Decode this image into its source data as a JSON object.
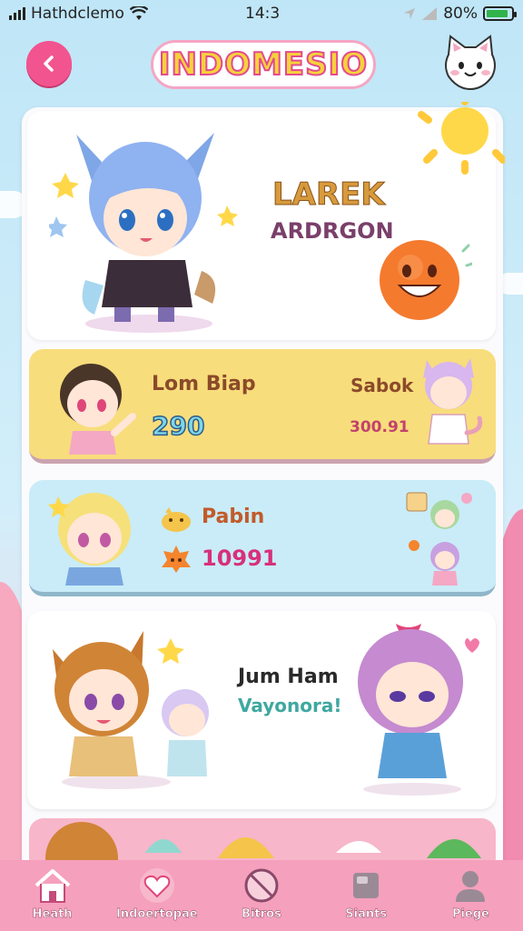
{
  "status_bar": {
    "carrier": "Hathdclemo",
    "time": "14:3",
    "battery": "80%"
  },
  "header": {
    "title": "INDOMESIO",
    "back_icon": "chevron-left-icon",
    "profile_icon": "cat-face-icon"
  },
  "hero_card": {
    "name": "LAREK",
    "subtitle": "ARDRGON"
  },
  "card_yellow": {
    "title": "Lom Biap",
    "score": "290",
    "right_title": "Sabok",
    "right_value": "300.91"
  },
  "card_blue": {
    "title": "Pabin",
    "value": "10991"
  },
  "card_white": {
    "title": "Jum Ham",
    "subtitle": "Vayonora!"
  },
  "nav": {
    "items": [
      {
        "label": "Heath",
        "icon": "home-icon"
      },
      {
        "label": "Indoertopae",
        "icon": "heart-icon"
      },
      {
        "label": "Bitros",
        "icon": "no-entry-icon"
      },
      {
        "label": "Siants",
        "icon": "chat-icon"
      },
      {
        "label": "Piege",
        "icon": "person-icon"
      }
    ]
  },
  "colors": {
    "accent_pink": "#f2548f",
    "nav_bg": "#f5a0bd",
    "card_yellow": "#f8dd7c",
    "card_blue": "#c9ecf8"
  }
}
